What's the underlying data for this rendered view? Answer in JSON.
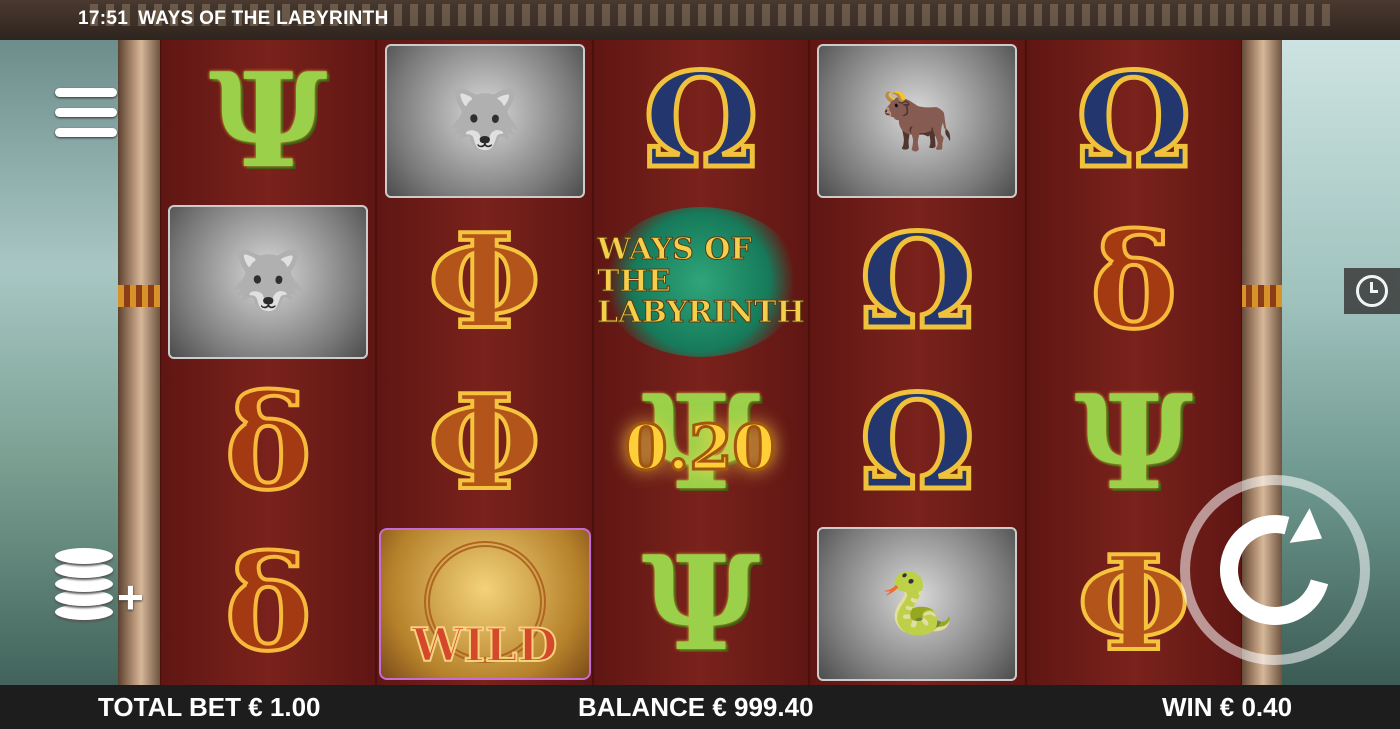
{
  "status": {
    "time": "17:51",
    "game_title": "WAYS OF THE LABYRINTH"
  },
  "reels": [
    [
      {
        "symbol": "psi",
        "glyph": "Ψ"
      },
      {
        "symbol": "cerberus",
        "glyph": "🐺"
      },
      {
        "symbol": "delta",
        "glyph": "δ"
      },
      {
        "symbol": "delta",
        "glyph": "δ"
      }
    ],
    [
      {
        "symbol": "cerberus",
        "glyph": "🐺"
      },
      {
        "symbol": "phi",
        "glyph": "Φ"
      },
      {
        "symbol": "phi",
        "glyph": "Φ"
      },
      {
        "symbol": "wild",
        "glyph": "",
        "label": "WILD"
      }
    ],
    [
      {
        "symbol": "omega",
        "glyph": "Ω"
      },
      {
        "symbol": "logo",
        "glyph": "",
        "label": "WAYS OF THE LABYRINTH"
      },
      {
        "symbol": "psi",
        "glyph": "Ψ"
      },
      {
        "symbol": "psi",
        "glyph": "Ψ"
      }
    ],
    [
      {
        "symbol": "minotaur",
        "glyph": "🐂"
      },
      {
        "symbol": "omega",
        "glyph": "Ω"
      },
      {
        "symbol": "omega",
        "glyph": "Ω"
      },
      {
        "symbol": "medusa",
        "glyph": "🐍"
      }
    ],
    [
      {
        "symbol": "omega",
        "glyph": "Ω"
      },
      {
        "symbol": "delta",
        "glyph": "δ"
      },
      {
        "symbol": "psi",
        "glyph": "Ψ"
      },
      {
        "symbol": "phi",
        "glyph": "Φ"
      }
    ]
  ],
  "win_popup": "0.20",
  "footer": {
    "total_bet": "TOTAL BET € 1.00",
    "balance": "BALANCE € 999.40",
    "win": "WIN € 0.40"
  },
  "icons": {
    "menu": "hamburger-icon",
    "coins": "coins-plus-icon",
    "history": "history-clock-icon",
    "spin": "spin-arrow-icon"
  }
}
